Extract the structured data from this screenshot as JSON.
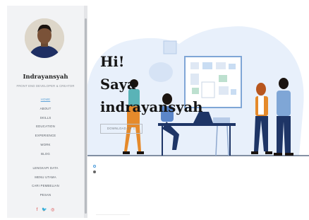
{
  "profile": {
    "name": "Indrayansyah",
    "role": "FRONT END DEVELOPER & CREATOR"
  },
  "nav": {
    "items": [
      {
        "label": "HOME",
        "active": true
      },
      {
        "label": "ABOUT"
      },
      {
        "label": "SKILLS"
      },
      {
        "label": "EDUCATION"
      },
      {
        "label": "EXPERIENCE"
      },
      {
        "label": "WORK"
      },
      {
        "label": "BLOG"
      }
    ],
    "secondary": [
      {
        "label": "LENGKAPI DATA"
      },
      {
        "label": "MENU UTAMA"
      },
      {
        "label": "CARI PEMBELIAN"
      },
      {
        "label": "PESAN"
      }
    ]
  },
  "social": [
    {
      "icon": "facebook-icon",
      "glyph": "f"
    },
    {
      "icon": "twitter-icon",
      "glyph": "🐦"
    },
    {
      "icon": "instagram-icon",
      "glyph": "◎"
    }
  ],
  "hero": {
    "line1": "Hi!",
    "line2": "Saya",
    "line3": "indrayansyah",
    "button": "DOWNLOAD CV ⇩"
  },
  "colors": {
    "accent": "#5fa3d8",
    "illustration_bg": "#e8f0fb",
    "orange": "#e58a2b",
    "navy": "#1e3566"
  }
}
